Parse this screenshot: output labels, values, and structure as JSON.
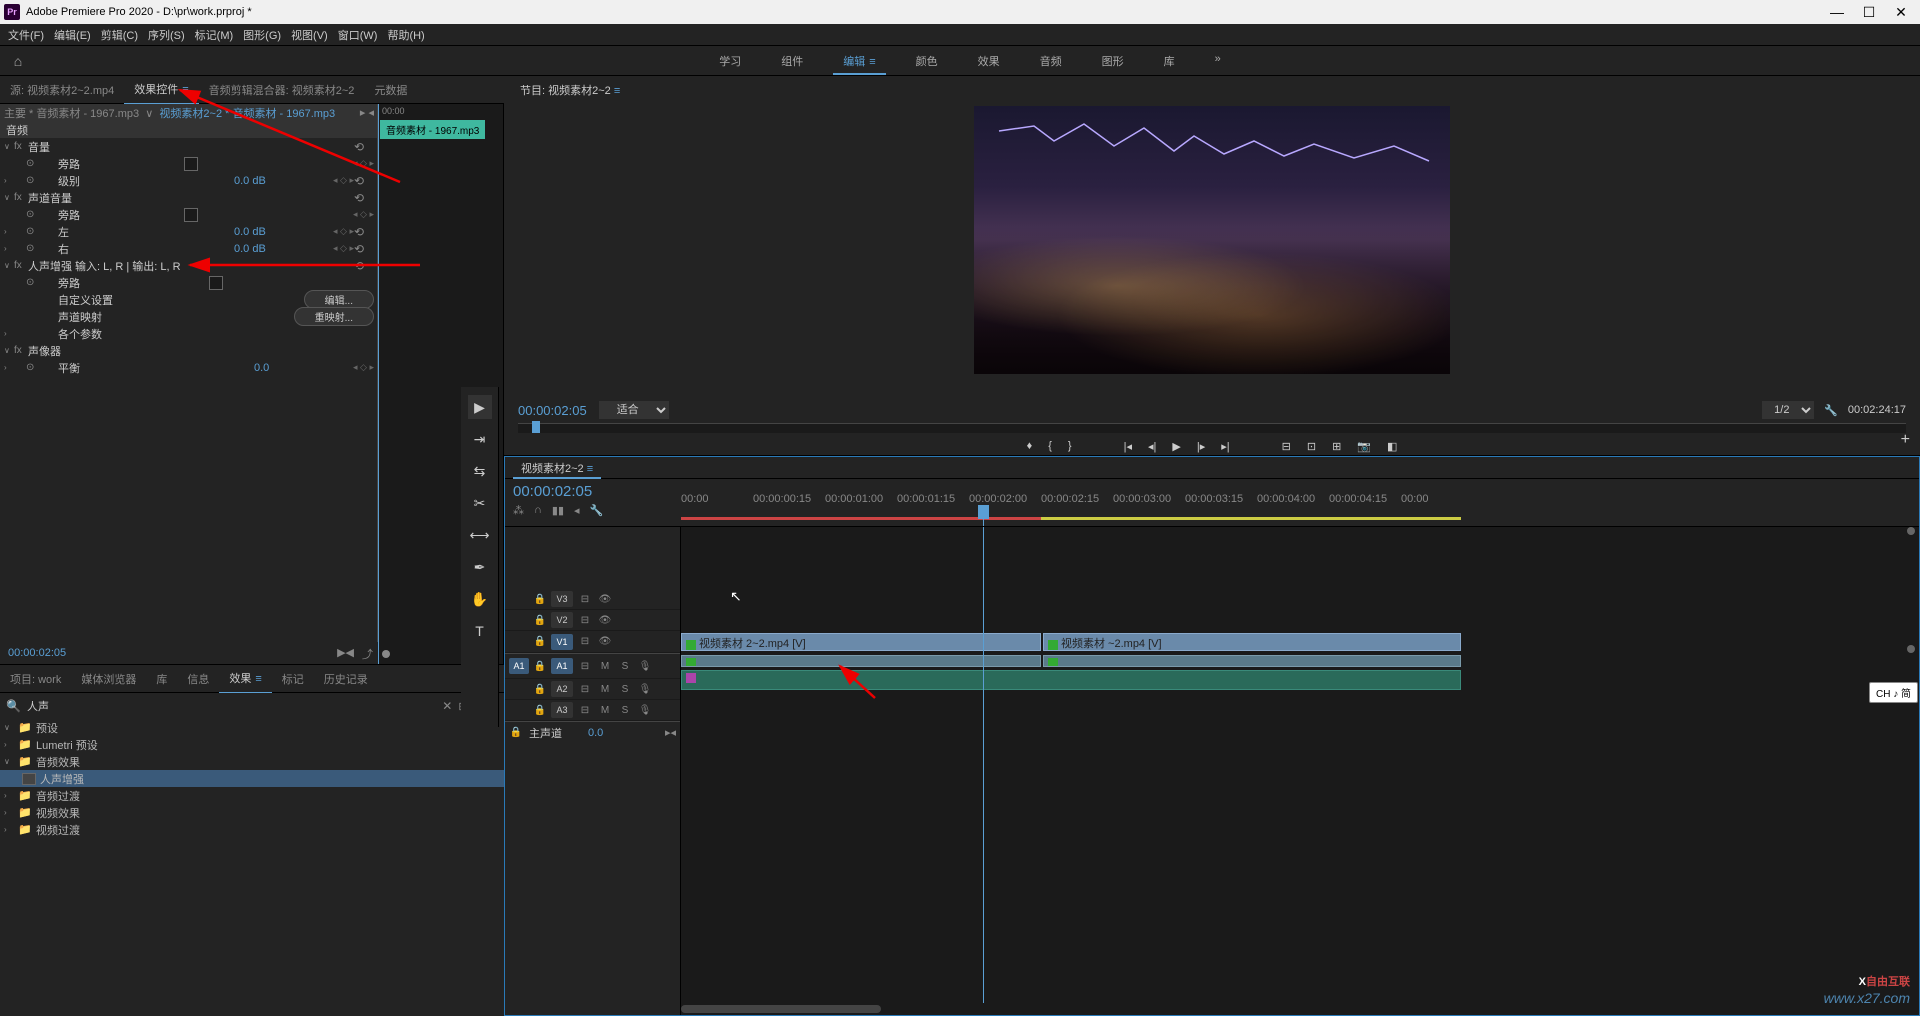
{
  "app": {
    "title": "Adobe Premiere Pro 2020 - D:\\pr\\work.prproj *",
    "icon_text": "Pr"
  },
  "menu": [
    "文件(F)",
    "编辑(E)",
    "剪辑(C)",
    "序列(S)",
    "标记(M)",
    "图形(G)",
    "视图(V)",
    "窗口(W)",
    "帮助(H)"
  ],
  "workspaces": {
    "items": [
      "学习",
      "组件",
      "编辑",
      "颜色",
      "效果",
      "音频",
      "图形",
      "库"
    ],
    "active_index": 2,
    "overflow": "»"
  },
  "source_panel": {
    "tabs": [
      "源: 视频素材2~2.mp4",
      "效果控件",
      "音频剪辑混合器: 视频素材2~2",
      "元数据"
    ],
    "active_index": 1
  },
  "effect_controls": {
    "breadcrumb_master": "主要 * 音频素材 - 1967.mp3",
    "breadcrumb_link": "视频素材2~2 * 音频素材 - 1967.mp3",
    "timeline_start": "00:00",
    "clip_label": "音频素材 - 1967.mp3",
    "section_audio": "音频",
    "fx_volume": "音量",
    "prop_bypass": "旁路",
    "prop_level": "级别",
    "val_level": "0.0 dB",
    "fx_channel_volume": "声道音量",
    "prop_left": "左",
    "val_left": "0.0 dB",
    "prop_right": "右",
    "val_right": "0.0 dB",
    "fx_voice_enhance": "人声增强 输入: L, R | 输出: L, R",
    "prop_custom": "自定义设置",
    "btn_edit": "编辑...",
    "prop_channel_map": "声道映射",
    "btn_remap": "重映射...",
    "prop_params": "各个参数",
    "fx_panner": "声像器",
    "prop_balance": "平衡",
    "val_balance": "0.0",
    "timecode": "00:00:02:05"
  },
  "project_panel": {
    "tabs": [
      "项目: work",
      "媒体浏览器",
      "库",
      "信息",
      "效果",
      "标记",
      "历史记录"
    ],
    "active_index": 4,
    "search_value": "人声",
    "tree": [
      {
        "type": "folder",
        "label": "预设",
        "expanded": true,
        "level": 0
      },
      {
        "type": "folder",
        "label": "Lumetri 预设",
        "expanded": false,
        "level": 0
      },
      {
        "type": "folder",
        "label": "音频效果",
        "expanded": true,
        "level": 0
      },
      {
        "type": "effect",
        "label": "人声增强",
        "level": 1,
        "selected": true
      },
      {
        "type": "folder",
        "label": "音频过渡",
        "expanded": false,
        "level": 0
      },
      {
        "type": "folder",
        "label": "视频效果",
        "expanded": false,
        "level": 0
      },
      {
        "type": "folder",
        "label": "视频过渡",
        "expanded": false,
        "level": 0
      }
    ]
  },
  "program_monitor": {
    "tab": "节目: 视频素材2~2",
    "timecode": "00:00:02:05",
    "fit": "适合",
    "scale": "1/2",
    "duration": "00:02:24:17"
  },
  "timeline": {
    "tab": "视频素材2~2",
    "timecode": "00:00:02:05",
    "ruler_ticks": [
      "00:00",
      "00:00:00:15",
      "00:00:01:00",
      "00:00:01:15",
      "00:00:02:00",
      "00:00:02:15",
      "00:00:03:00",
      "00:00:03:15",
      "00:00:04:00",
      "00:00:04:15",
      "00:00"
    ],
    "tracks_video": [
      {
        "label": "V3"
      },
      {
        "label": "V2"
      },
      {
        "label": "V1",
        "active": true
      }
    ],
    "tracks_audio": [
      {
        "label": "A1",
        "src": "A1",
        "active": true
      },
      {
        "label": "A2"
      },
      {
        "label": "A3"
      }
    ],
    "master_label": "主声道",
    "master_value": "0.0",
    "clips": {
      "v1_a": "视频素材 2~2.mp4 [V]",
      "v1_b": "视频素材 ~2.mp4 [V]"
    }
  },
  "ime": "CH ♪ 简",
  "watermark": "www.x27.com",
  "watermark_brand": "自由互联"
}
